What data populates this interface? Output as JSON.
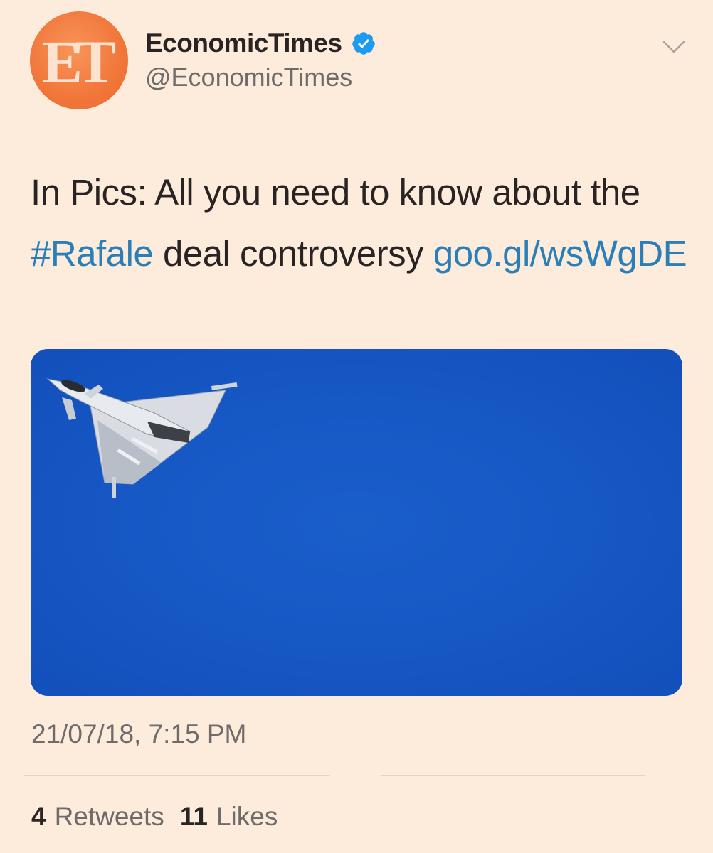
{
  "avatar": {
    "text": "ET",
    "color": "#f1763a"
  },
  "user": {
    "display_name": "EconomicTimes",
    "handle": "@EconomicTimes",
    "verified": true,
    "verified_icon": "verified-badge-icon"
  },
  "menu_icon": "chevron-down-icon",
  "tweet": {
    "text_prefix": "In Pics: All you need to know about the ",
    "hashtag": "#Rafale",
    "text_middle": " deal controversy ",
    "link": "goo.gl/wsWgDE"
  },
  "media": {
    "description_icon": "fighter-jet-image",
    "sky_color": "#1657c4"
  },
  "timestamp": "21/07/18, 7:15 PM",
  "stats": {
    "retweets_count": "4",
    "retweets_label": "Retweets",
    "likes_count": "11",
    "likes_label": "Likes"
  },
  "colors": {
    "background": "#fdebdb",
    "link": "#2a7fb8",
    "text": "#2a2323",
    "muted": "#6e6b6a"
  }
}
